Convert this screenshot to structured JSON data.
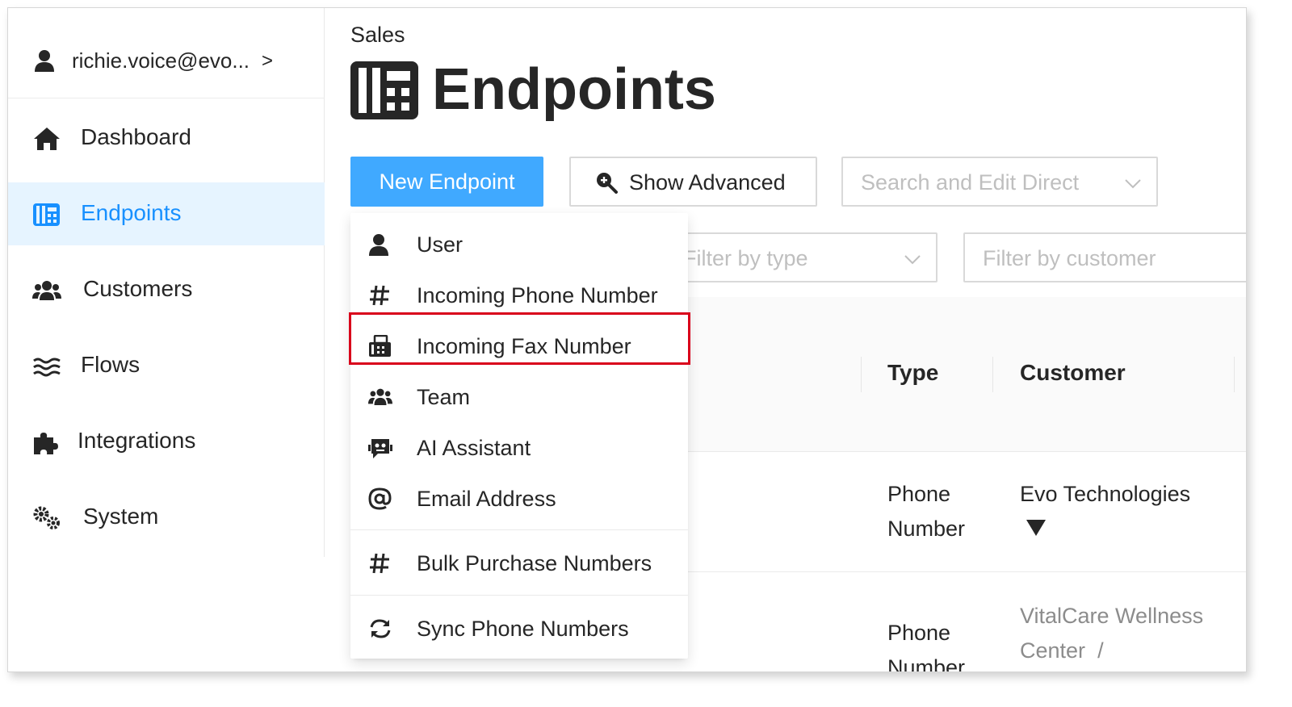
{
  "sidebar": {
    "user_email": "richie.voice@evo...",
    "user_chevron": ">",
    "items": [
      {
        "label": "Dashboard",
        "icon": "home-icon"
      },
      {
        "label": "Endpoints",
        "icon": "endpoints-icon",
        "active": true
      },
      {
        "label": "Customers",
        "icon": "users-icon"
      },
      {
        "label": "Flows",
        "icon": "flows-icon"
      },
      {
        "label": "Integrations",
        "icon": "puzzle-icon"
      },
      {
        "label": "System",
        "icon": "gears-icon"
      }
    ]
  },
  "header": {
    "breadcrumb": "Sales",
    "title": "Endpoints"
  },
  "toolbar": {
    "new_endpoint": "New Endpoint",
    "show_advanced": "Show Advanced",
    "search_placeholder": "Search and Edit Direct"
  },
  "filters": {
    "type_placeholder": "Filter by type",
    "customer_placeholder": "Filter by customer"
  },
  "table": {
    "columns": [
      "Type",
      "Customer"
    ],
    "rows": [
      {
        "type": [
          "Phone",
          "Number"
        ],
        "customer": "Evo Technologies"
      },
      {
        "type": [
          "Phone",
          "Number"
        ],
        "customer": [
          "VitalCare Wellness",
          "Center"
        ],
        "customer_sep": "/"
      }
    ]
  },
  "menu": {
    "items": [
      {
        "label": "User",
        "icon": "user-icon"
      },
      {
        "label": "Incoming Phone Number",
        "icon": "hash-icon"
      },
      {
        "label": "Incoming Fax Number",
        "icon": "fax-icon",
        "highlighted": true
      },
      {
        "label": "Team",
        "icon": "team-icon"
      },
      {
        "label": "AI Assistant",
        "icon": "robot-icon"
      },
      {
        "label": "Email Address",
        "icon": "at-icon"
      },
      {
        "label": "Bulk Purchase Numbers",
        "icon": "hash-icon"
      },
      {
        "label": "Sync Phone Numbers",
        "icon": "sync-icon"
      }
    ]
  },
  "colors": {
    "primary": "#40a9ff",
    "active_text": "#1890ff",
    "active_bg": "#e6f4ff",
    "highlight_border": "#d9001b"
  }
}
